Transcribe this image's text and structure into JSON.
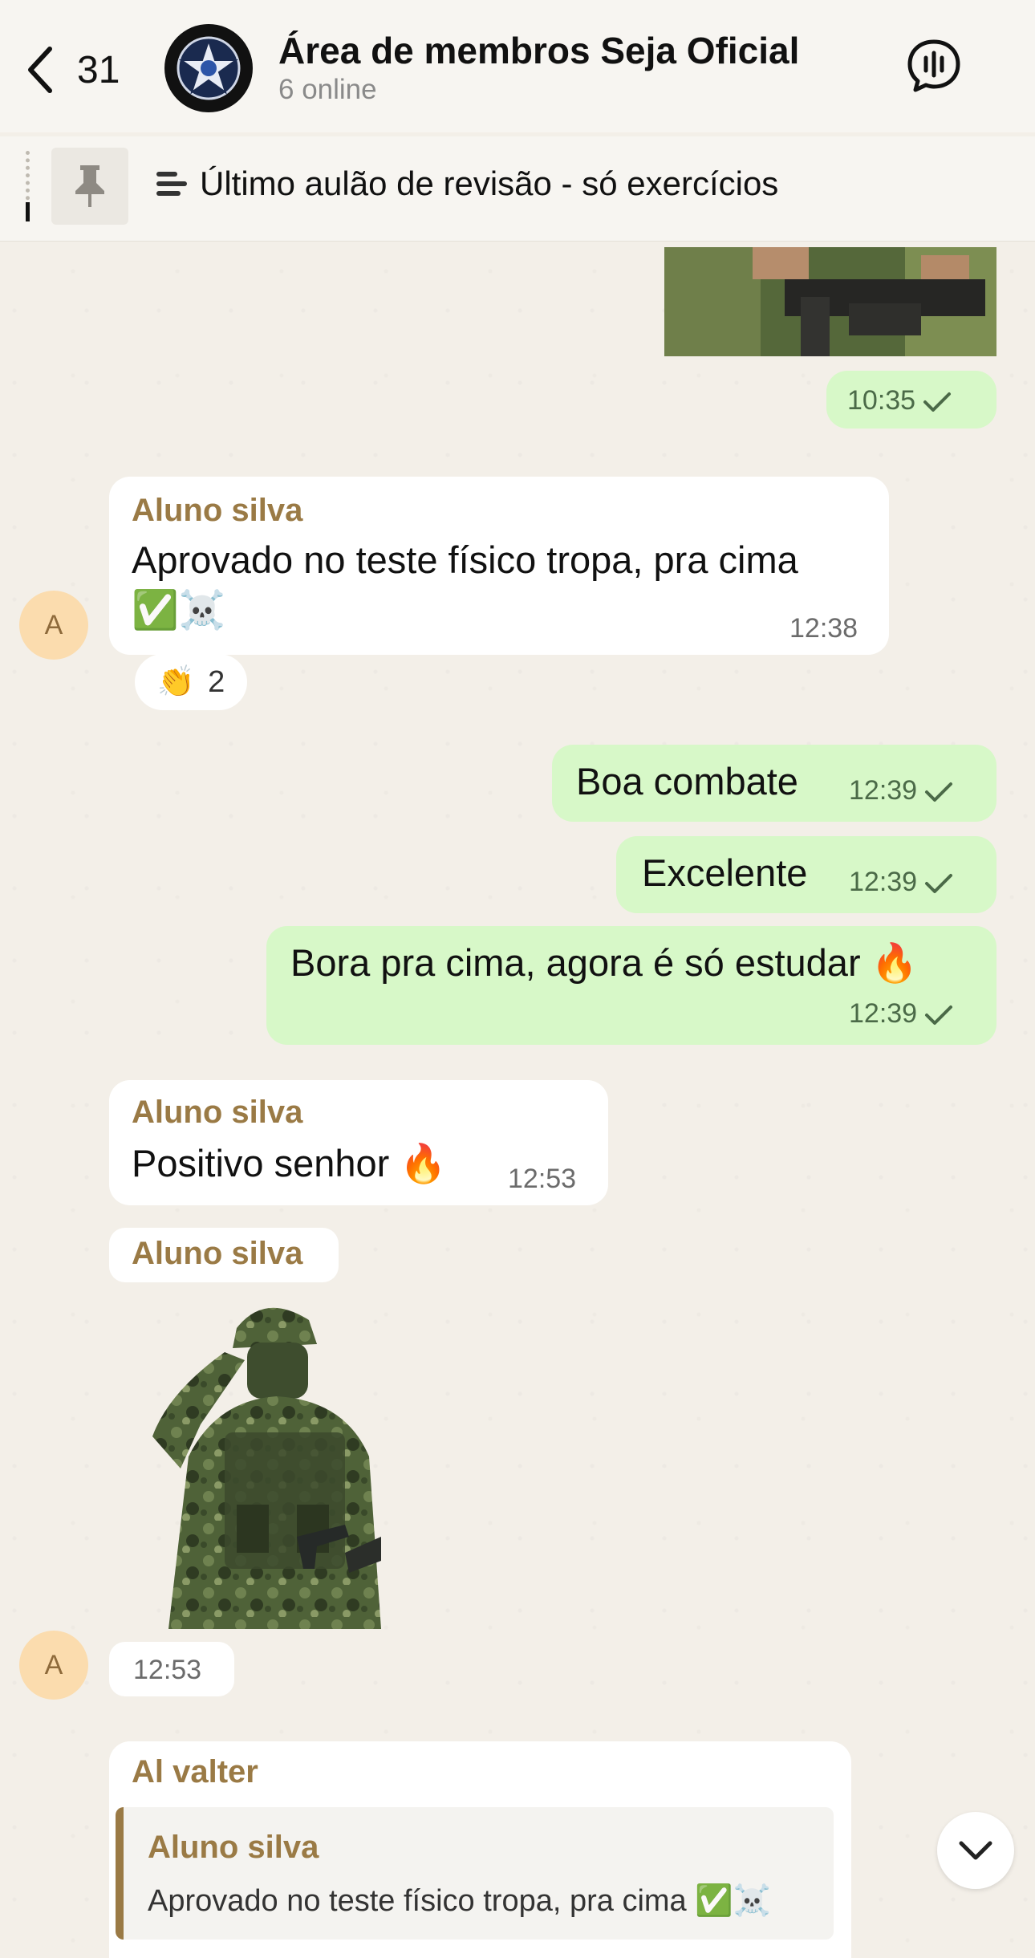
{
  "header": {
    "back_count": "31",
    "title": "Área de membros Seja Oficial",
    "subtitle": "6 online"
  },
  "pinned": {
    "text": "Último aulão de revisão - só exercícios"
  },
  "messages": [
    {
      "id": "m1",
      "direction": "out",
      "type": "image",
      "time": "10:35"
    },
    {
      "id": "m2",
      "direction": "in",
      "sender": "Aluno silva",
      "line1": "Aprovado no teste físico tropa, pra cima",
      "line2_emoji": "✅☠️",
      "time": "12:38",
      "reaction": {
        "emoji": "👏",
        "count": "2"
      }
    },
    {
      "id": "m3",
      "direction": "out",
      "text": "Boa combate",
      "time": "12:39"
    },
    {
      "id": "m4",
      "direction": "out",
      "text": "Excelente",
      "time": "12:39"
    },
    {
      "id": "m5",
      "direction": "out",
      "text": "Bora pra cima, agora é só estudar 🔥",
      "time": "12:39"
    },
    {
      "id": "m6",
      "direction": "in",
      "sender": "Aluno silva",
      "text": "Positivo senhor 🔥",
      "time": "12:53"
    },
    {
      "id": "m7",
      "direction": "in",
      "sender": "Aluno silva",
      "type": "sticker",
      "time": "12:53"
    },
    {
      "id": "m8",
      "direction": "in",
      "sender": "Al valter",
      "quote_sender": "Aluno silva",
      "quote_text": "Aprovado no teste físico tropa, pra cima ✅☠️"
    }
  ],
  "avatar_letter": "A",
  "colors": {
    "outgoing": "#d7f8c8",
    "incoming": "#ffffff",
    "sender": "#9a7a45",
    "background": "#f3efe8"
  }
}
